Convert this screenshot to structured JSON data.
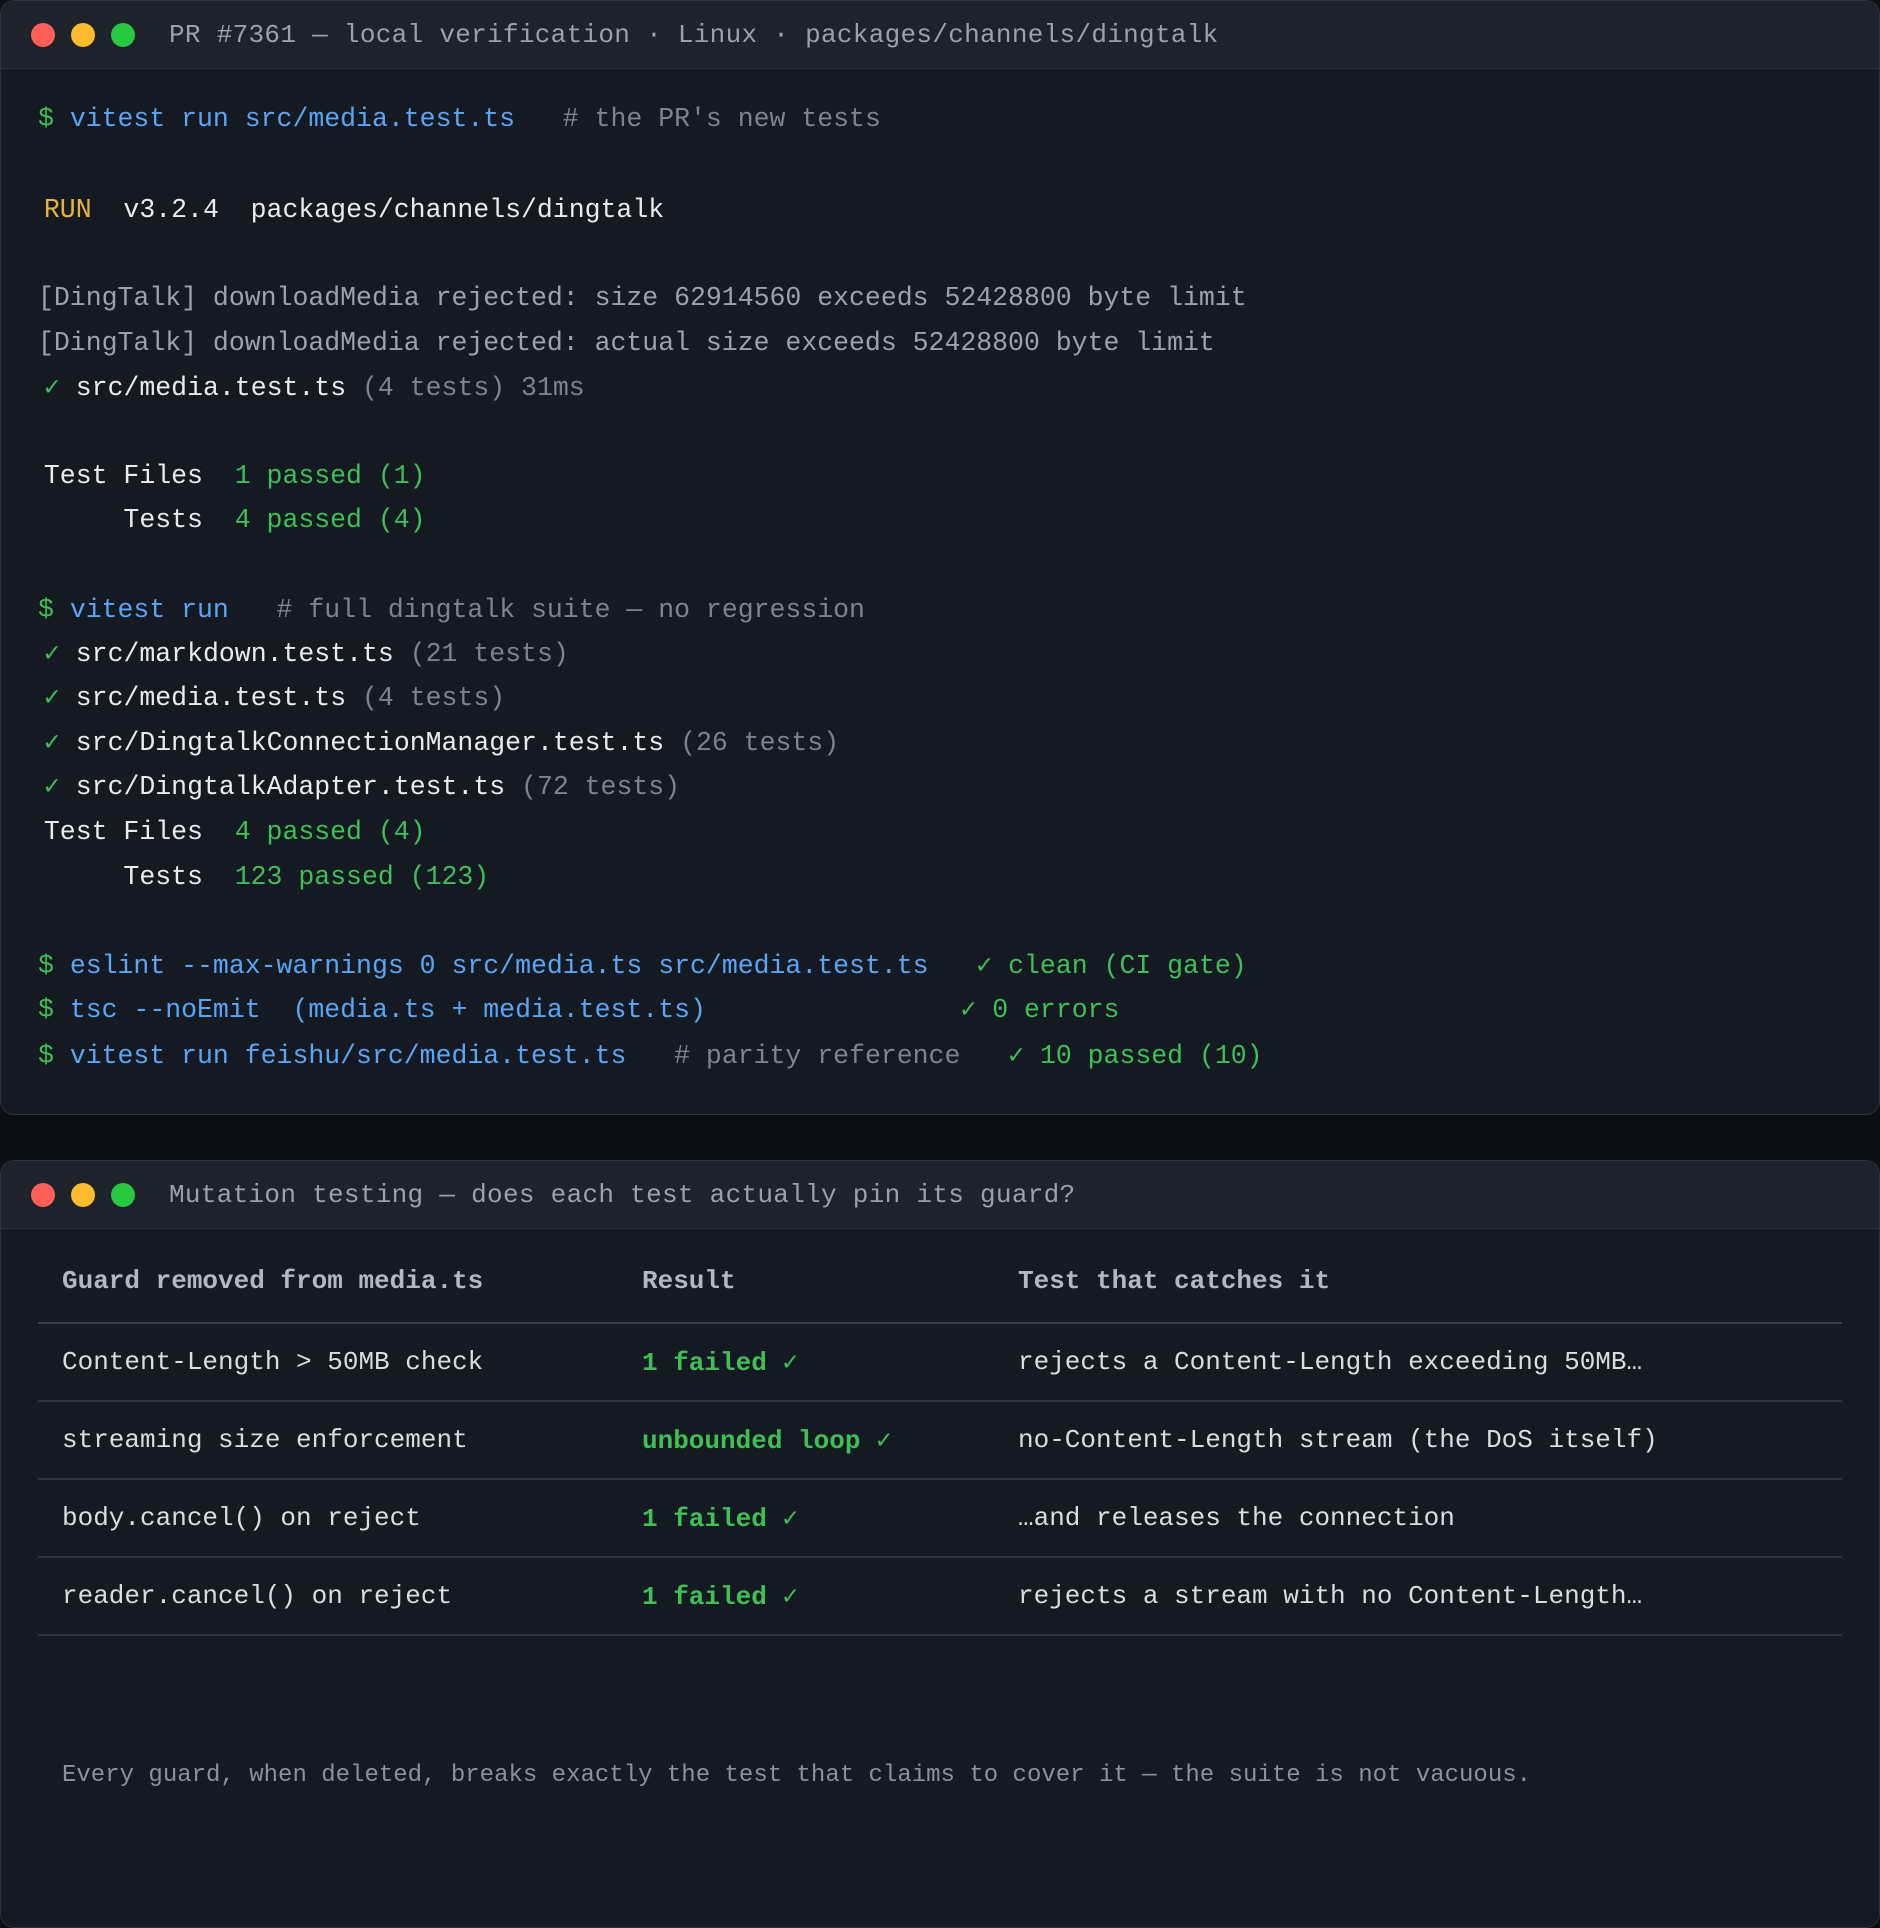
{
  "window1": {
    "title": "PR #7361 — local verification · Linux · packages/channels/dingtalk",
    "lines": {
      "l1": {
        "prompt": "$ ",
        "cmd": "vitest run src/media.test.ts",
        "comment": "   # the PR's new tests"
      },
      "l2": {
        "run": " RUN",
        "rest": "  v3.2.4  packages/channels/dingtalk"
      },
      "l3": "[DingTalk] downloadMedia rejected: size 62914560 exceeds 52428800 byte limit",
      "l4": "[DingTalk] downloadMedia rejected: actual size exceeds 52428800 byte limit",
      "l5": {
        "check": " ✓ ",
        "file": "src/media.test.ts",
        "info": " (4 tests) 31ms"
      },
      "l6": {
        "label": " Test Files  ",
        "value": "1 passed (1)"
      },
      "l7": {
        "label": "      Tests  ",
        "value": "4 passed (4)"
      },
      "l8": {
        "prompt": "$ ",
        "cmd": "vitest run",
        "comment": "   # full dingtalk suite — no regression"
      },
      "l9": {
        "check": " ✓ ",
        "file": "src/markdown.test.ts",
        "info": " (21 tests)"
      },
      "l10": {
        "check": " ✓ ",
        "file": "src/media.test.ts",
        "info": " (4 tests)"
      },
      "l11": {
        "check": " ✓ ",
        "file": "src/DingtalkConnectionManager.test.ts",
        "info": " (26 tests)"
      },
      "l12": {
        "check": " ✓ ",
        "file": "src/DingtalkAdapter.test.ts",
        "info": " (72 tests)"
      },
      "l13": {
        "label": " Test Files  ",
        "value": "4 passed (4)"
      },
      "l14": {
        "label": "      Tests  ",
        "value": "123 passed (123)"
      },
      "l15": {
        "prompt": "$ ",
        "cmd": "eslint --max-warnings 0 src/media.ts src/media.test.ts",
        "result": "   ✓ clean (CI gate)"
      },
      "l16": {
        "prompt": "$ ",
        "cmd": "tsc --noEmit  (media.ts + media.test.ts)",
        "result": "                ✓ 0 errors"
      },
      "l17": {
        "prompt": "$ ",
        "cmd": "vitest run feishu/src/media.test.ts",
        "comment": "   # parity reference",
        "result": "   ✓ 10 passed (10)"
      }
    }
  },
  "window2": {
    "title": "Mutation testing — does each test actually pin its guard?",
    "headers": [
      "Guard removed from media.ts",
      "Result",
      "Test that catches it"
    ],
    "rows": [
      {
        "guard": "Content-Length > 50MB check",
        "result": "1 failed ✓",
        "test": "rejects a Content-Length exceeding 50MB…"
      },
      {
        "guard": "streaming size enforcement",
        "result": "unbounded loop ✓",
        "test": "no-Content-Length stream (the DoS itself)"
      },
      {
        "guard": "body.cancel() on reject",
        "result": "1 failed ✓",
        "test": "…and releases the connection"
      },
      {
        "guard": "reader.cancel() on reject",
        "result": "1 failed ✓",
        "test": "rejects a stream with no Content-Length…"
      }
    ],
    "footer": "Every guard, when deleted, breaks exactly the test that claims to cover it — the suite is not vacuous."
  }
}
